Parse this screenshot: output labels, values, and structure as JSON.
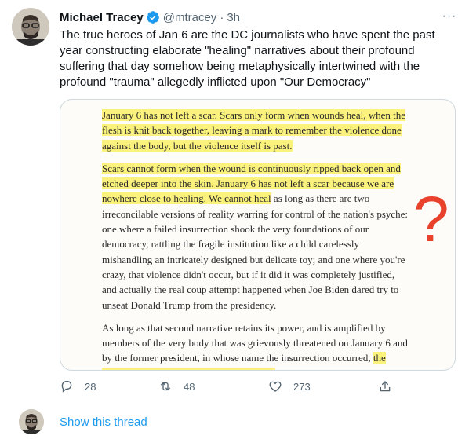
{
  "tweet": {
    "author_name": "Michael Tracey",
    "handle": "@mtracey",
    "separator": "·",
    "time": "3h",
    "more_label": "···",
    "text": "The true heroes of Jan 6 are the DC journalists who have spent the past year constructing elaborate \"healing\" narratives about their profound suffering that day somehow being metaphysically intertwined with the profound \"trauma\" allegedly inflicted upon \"Our Democracy\"",
    "verified_color": "#1d9bf0"
  },
  "media": {
    "p1_highlight": "January 6 has not left a scar. Scars only form when wounds heal, when the flesh is knit back together, leaving a mark to remember the violence done against the body, but the violence itself is past.",
    "p2_highlight": "Scars cannot form when the wound is continuously ripped back open and etched deeper into the skin. January 6 has not left a scar because we are nowhere close to healing. We cannot heal",
    "p2_rest": " as long as there are two irreconcilable versions of reality warring for control of the nation's psyche: one where a failed insurrection shook the very foundations of our democracy, rattling the fragile institution like a child carelessly mishandling an intricately designed but delicate toy; and one where you're crazy, that violence didn't occur, but if it did it was completely justified, and actually the real coup attempt happened when Joe Biden dared try to unseat Donald Trump from the presidency.",
    "p3_rest": "As long as that second narrative retains its power, and is amplified by members of the very body that was grievously threatened on January 6 and by the former president, in whose name the insurrection occurred, ",
    "p3_highlight": "the wound will remain open, and it will fester.",
    "question_mark": "?",
    "highlight_color": "#fbf27d",
    "annotation_color": "#e8412c"
  },
  "actions": {
    "reply_icon": "reply-icon",
    "reply_count": "28",
    "retweet_icon": "retweet-icon",
    "retweet_count": "48",
    "like_icon": "heart-icon",
    "like_count": "273",
    "share_icon": "share-icon"
  },
  "thread": {
    "show_thread_label": "Show this thread",
    "link_color": "#1d9bf0"
  }
}
